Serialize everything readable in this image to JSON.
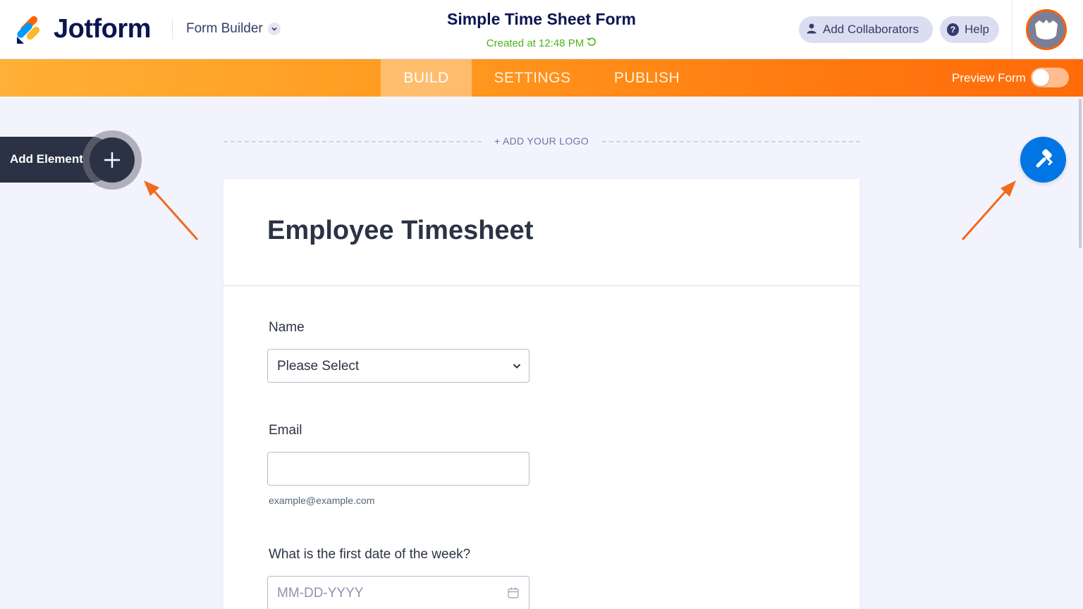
{
  "header": {
    "brand": "Jotform",
    "form_builder_label": "Form Builder",
    "form_title": "Simple Time Sheet Form",
    "created_text": "Created at 12:48 PM",
    "add_collaborators_label": "Add Collaborators",
    "help_label": "Help",
    "icons": {
      "logo": "jotform-logo-icon",
      "collaborators": "user-icon",
      "help": "question-circle-icon",
      "refresh": "refresh-icon",
      "chevron": "chevron-down-icon"
    }
  },
  "nav": {
    "tabs": [
      {
        "label": "BUILD",
        "active": true
      },
      {
        "label": "SETTINGS",
        "active": false
      },
      {
        "label": "PUBLISH",
        "active": false
      }
    ],
    "preview_label": "Preview Form",
    "preview_enabled": false
  },
  "builder": {
    "add_element_label": "Add Element",
    "add_logo_label": "+ ADD YOUR LOGO",
    "designer_icon": "paint-roller-icon"
  },
  "form": {
    "title": "Employee Timesheet",
    "fields": [
      {
        "label": "Name",
        "type": "select",
        "value": "Please Select"
      },
      {
        "label": "Email",
        "type": "email",
        "value": "",
        "sublabel": "example@example.com"
      },
      {
        "label": "What is the first date of the week?",
        "type": "date",
        "placeholder": "MM-DD-YYYY"
      }
    ]
  },
  "colors": {
    "brand_orange": "#ff6100",
    "accent_blue": "#0075e3",
    "created_green": "#4cb320",
    "annotation_arrow": "#f26a1b"
  }
}
